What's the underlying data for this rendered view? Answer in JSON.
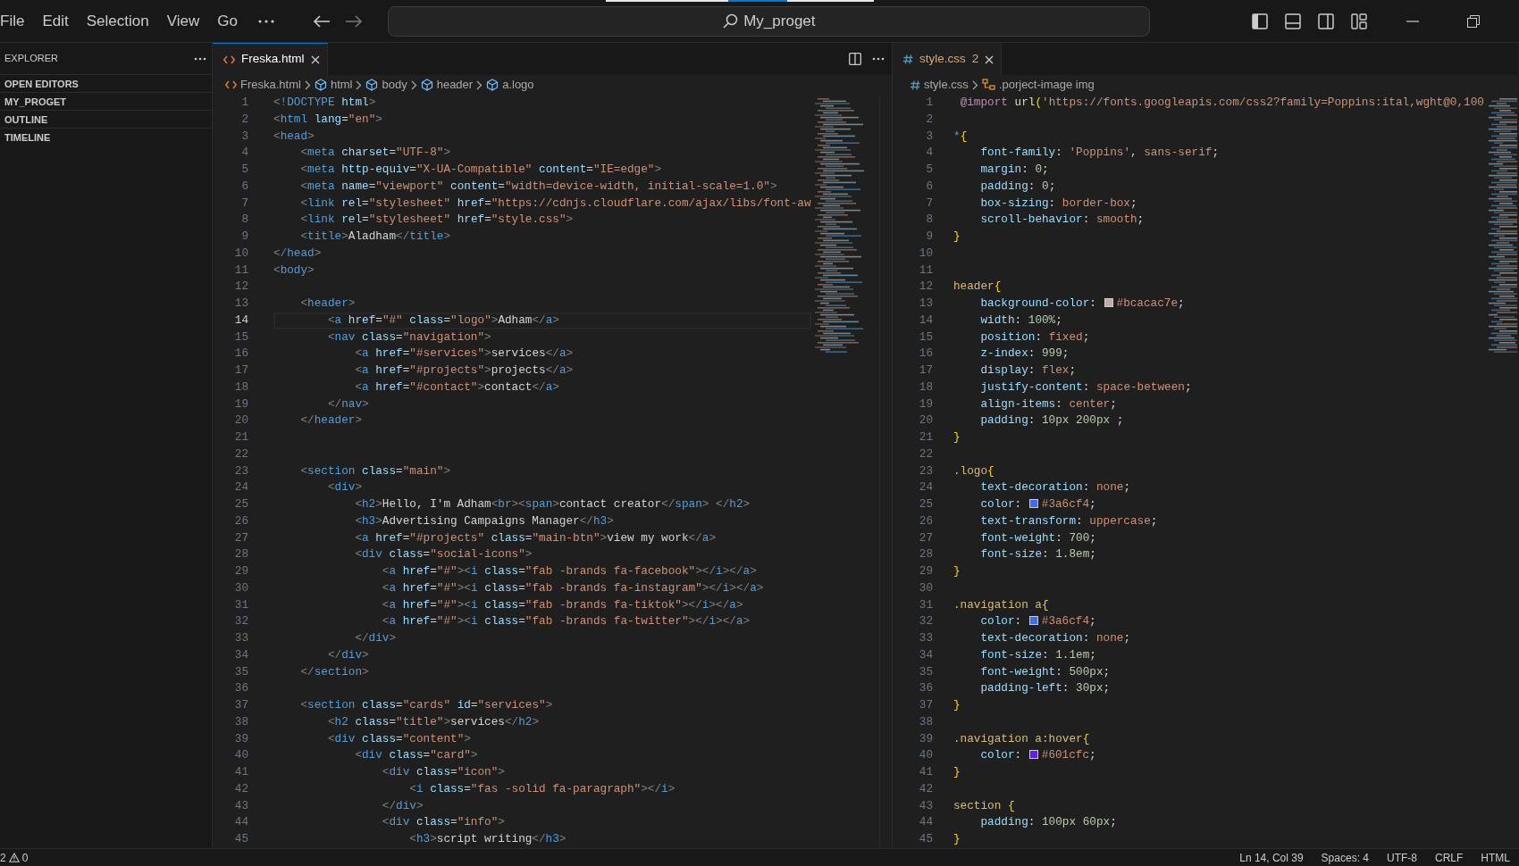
{
  "menu": [
    "File",
    "Edit",
    "Selection",
    "View",
    "Go"
  ],
  "command_center": {
    "text": "My_proget"
  },
  "sidebar": {
    "title": "EXPLORER",
    "sections": [
      "OPEN EDITORS",
      "MY_PROGET",
      "OUTLINE",
      "TIMELINE"
    ]
  },
  "editors": [
    {
      "kind": "html",
      "focused": true,
      "tab": {
        "label": "Freska.html"
      },
      "breadcrumbs": [
        {
          "label": "Freska.html",
          "kind": "file"
        },
        {
          "label": "html",
          "kind": "element"
        },
        {
          "label": "body",
          "kind": "element"
        },
        {
          "label": "header",
          "kind": "element"
        },
        {
          "label": "a.logo",
          "kind": "element"
        }
      ],
      "lines": [
        {
          "n": "1",
          "text": "<!DOCTYPE html>",
          "current": false
        },
        {
          "n": "2",
          "text": "<html lang=\"en\">",
          "current": false
        },
        {
          "n": "3",
          "text": "<head>",
          "current": false
        },
        {
          "n": "4",
          "text": "    <meta charset=\"UTF-8\">",
          "current": false
        },
        {
          "n": "5",
          "text": "    <meta http-equiv=\"X-UA-Compatible\" content=\"IE=edge\">",
          "current": false
        },
        {
          "n": "6",
          "text": "    <meta name=\"viewport\" content=\"width=device-width, initial-scale=1.0\">",
          "current": false
        },
        {
          "n": "7",
          "text": "    <link rel=\"stylesheet\" href=\"https://cdnjs.cloudflare.com/ajax/libs/font-aw",
          "current": false
        },
        {
          "n": "8",
          "text": "    <link rel=\"stylesheet\" href=\"style.css\">",
          "current": false
        },
        {
          "n": "9",
          "text": "    <title>Aladham</title>",
          "current": false
        },
        {
          "n": "10",
          "text": "</head>",
          "current": false
        },
        {
          "n": "11",
          "text": "<body>",
          "current": false
        },
        {
          "n": "12",
          "current": false
        },
        {
          "n": "13",
          "text": "    <header>",
          "current": false
        },
        {
          "n": "14",
          "text": "        <a href=\"#\" class=\"logo\">Adham</a>",
          "current": true
        },
        {
          "n": "15",
          "text": "        <nav class=\"navigation\">",
          "current": false
        },
        {
          "n": "16",
          "text": "            <a href=\"#services\">services</a>",
          "current": false
        },
        {
          "n": "17",
          "text": "            <a href=\"#projects\">projects</a>",
          "current": false
        },
        {
          "n": "18",
          "text": "            <a href=\"#contact\">contact</a>",
          "current": false
        },
        {
          "n": "19",
          "text": "        </nav>",
          "current": false
        },
        {
          "n": "20",
          "text": "    </header>",
          "current": false
        },
        {
          "n": "21",
          "current": false
        },
        {
          "n": "22",
          "current": false
        },
        {
          "n": "23",
          "text": "    <section class=\"main\">",
          "current": false
        },
        {
          "n": "24",
          "text": "        <div>",
          "current": false
        },
        {
          "n": "25",
          "text": "            <h2>Hello, I'm Adham<br><span>contact creator</span> </h2>",
          "current": false
        },
        {
          "n": "26",
          "text": "            <h3>Advertising Campaigns Manager</h3>",
          "current": false
        },
        {
          "n": "27",
          "text": "            <a href=\"#projects\" class=\"main-btn\">view my work</a>",
          "current": false
        },
        {
          "n": "28",
          "text": "            <div class=\"social-icons\">",
          "current": false
        },
        {
          "n": "29",
          "text": "                <a href=\"#\"><i class=\"fab -brands fa-facebook\"></i></a>",
          "current": false
        },
        {
          "n": "30",
          "text": "                <a href=\"#\"><i class=\"fab -brands fa-instagram\"></i></a>",
          "current": false
        },
        {
          "n": "31",
          "text": "                <a href=\"#\"><i class=\"fab -brands fa-tiktok\"></i></a>",
          "current": false
        },
        {
          "n": "32",
          "text": "                <a href=\"#\"><i class=\"fab -brands fa-twitter\"></i></a>",
          "current": false
        },
        {
          "n": "33",
          "text": "            </div>",
          "current": false
        },
        {
          "n": "34",
          "text": "        </div>",
          "current": false
        },
        {
          "n": "35",
          "text": "    </section>",
          "current": false
        },
        {
          "n": "36",
          "current": false
        },
        {
          "n": "37",
          "text": "    <section class=\"cards\" id=\"services\">",
          "current": false
        },
        {
          "n": "38",
          "text": "        <h2 class=\"title\">services</h2>",
          "current": false
        },
        {
          "n": "39",
          "text": "        <div class=\"content\">",
          "current": false
        },
        {
          "n": "40",
          "text": "            <div class=\"card\">",
          "current": false
        },
        {
          "n": "41",
          "text": "                <div class=\"icon\">",
          "current": false
        },
        {
          "n": "42",
          "text": "                    <i class=\"fas -solid fa-paragraph\"></i>",
          "current": false
        },
        {
          "n": "43",
          "text": "                </div>",
          "current": false
        },
        {
          "n": "44",
          "text": "                <div class=\"info\">",
          "current": false
        },
        {
          "n": "45",
          "text": "                    <h3>script writing</h3>",
          "current": false
        }
      ]
    },
    {
      "kind": "css",
      "focused": false,
      "tab": {
        "label": "style.css",
        "problems": "2"
      },
      "breadcrumbs": [
        {
          "label": "style.css",
          "kind": "file"
        },
        {
          "label": ".porject-image img",
          "kind": "selector"
        }
      ],
      "lines": [
        {
          "n": "1",
          "text": " @import url('https://fonts.googleapis.com/css2?family=Poppins:ital,wght@0,100"
        },
        {
          "n": "2"
        },
        {
          "n": "3",
          "text": "*{"
        },
        {
          "n": "4",
          "text": "    font-family: 'Poppins', sans-serif;"
        },
        {
          "n": "5",
          "text": "    margin: 0;"
        },
        {
          "n": "6",
          "text": "    padding: 0;"
        },
        {
          "n": "7",
          "text": "    box-sizing: border-box;"
        },
        {
          "n": "8",
          "text": "    scroll-behavior: smooth;"
        },
        {
          "n": "9",
          "text": "}"
        },
        {
          "n": "10"
        },
        {
          "n": "11"
        },
        {
          "n": "12",
          "text": "header{"
        },
        {
          "n": "13",
          "text": "    background-color: #bcacac7e;",
          "color": "#bcacac"
        },
        {
          "n": "14",
          "text": "    width: 100%;"
        },
        {
          "n": "15",
          "text": "    position: fixed;"
        },
        {
          "n": "16",
          "text": "    z-index: 999;"
        },
        {
          "n": "17",
          "text": "    display: flex;"
        },
        {
          "n": "18",
          "text": "    justify-content: space-between;"
        },
        {
          "n": "19",
          "text": "    align-items: center;"
        },
        {
          "n": "20",
          "text": "    padding: 10px 200px ;"
        },
        {
          "n": "21",
          "text": "}"
        },
        {
          "n": "22"
        },
        {
          "n": "23",
          "text": ".logo{"
        },
        {
          "n": "24",
          "text": "    text-decoration: none;"
        },
        {
          "n": "25",
          "text": "    color: #3a6cf4;",
          "color": "#3a6cf4"
        },
        {
          "n": "26",
          "text": "    text-transform: uppercase;"
        },
        {
          "n": "27",
          "text": "    font-weight: 700;"
        },
        {
          "n": "28",
          "text": "    font-size: 1.8em;"
        },
        {
          "n": "29",
          "text": "}"
        },
        {
          "n": "30"
        },
        {
          "n": "31",
          "text": ".navigation a{"
        },
        {
          "n": "32",
          "text": "    color: #3a6cf4;",
          "color": "#3a6cf4"
        },
        {
          "n": "33",
          "text": "    text-decoration: none;"
        },
        {
          "n": "34",
          "text": "    font-size: 1.1em;"
        },
        {
          "n": "35",
          "text": "    font-weight: 500px;"
        },
        {
          "n": "36",
          "text": "    padding-left: 30px;"
        },
        {
          "n": "37",
          "text": "}"
        },
        {
          "n": "38"
        },
        {
          "n": "39",
          "text": ".navigation a:hover{"
        },
        {
          "n": "40",
          "text": "    color: #601cfc;",
          "color": "#601cfc"
        },
        {
          "n": "41",
          "text": "}"
        },
        {
          "n": "42"
        },
        {
          "n": "43",
          "text": "section {"
        },
        {
          "n": "44",
          "text": "    padding: 100px 60px;"
        },
        {
          "n": "45",
          "text": "}"
        }
      ]
    }
  ],
  "status_bar": {
    "errors": "2",
    "warnings": "0",
    "items": [
      "Ln 14, Col 39",
      "Spaces: 4",
      "UTF-8",
      "CRLF",
      "HTML"
    ]
  }
}
